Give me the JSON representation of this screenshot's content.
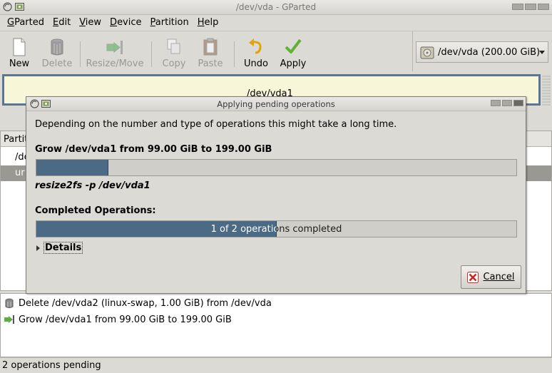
{
  "window": {
    "title": "/dev/vda - GParted"
  },
  "menu": {
    "items": [
      {
        "label": "GParted",
        "mnemonic": "G"
      },
      {
        "label": "Edit",
        "mnemonic": "E"
      },
      {
        "label": "View",
        "mnemonic": "V"
      },
      {
        "label": "Device",
        "mnemonic": "D"
      },
      {
        "label": "Partition",
        "mnemonic": "P"
      },
      {
        "label": "Help",
        "mnemonic": "H"
      }
    ]
  },
  "toolbar": {
    "new_label": "New",
    "delete_label": "Delete",
    "resize_label": "Resize/Move",
    "copy_label": "Copy",
    "paste_label": "Paste",
    "undo_label": "Undo",
    "apply_label": "Apply"
  },
  "device_selector": {
    "value": "/dev/vda   (200.00 GiB)"
  },
  "partition_graph": {
    "label": "/dev/vda1"
  },
  "partition_table": {
    "header_first": "Partiti",
    "row1_partition": "/de",
    "row2_partition": "ur"
  },
  "operations": [
    {
      "text": "Delete /dev/vda2 (linux-swap, 1.00 GiB) from /dev/vda",
      "icon": "delete-icon"
    },
    {
      "text": "Grow /dev/vda1 from 99.00 GiB to 199.00 GiB",
      "icon": "resize-icon"
    }
  ],
  "status": {
    "text": "2 operations pending"
  },
  "dialog": {
    "title": "Applying pending operations",
    "description": "Depending on the number and type of operations this might take a long time.",
    "current_operation": "Grow /dev/vda1 from 99.00 GiB to 199.00 GiB",
    "current_progress": 0.15,
    "command": "resize2fs -p /dev/vda1",
    "completed_label": "Completed Operations:",
    "completed_text": "1 of 2 operations completed",
    "completed_progress": 0.5,
    "details_label": "Details",
    "cancel_label": "Cancel"
  },
  "colors": {
    "progress_fill": "#4a6a86",
    "selection_border": "#5b7594",
    "partition_fill": "#f7f6d8"
  }
}
